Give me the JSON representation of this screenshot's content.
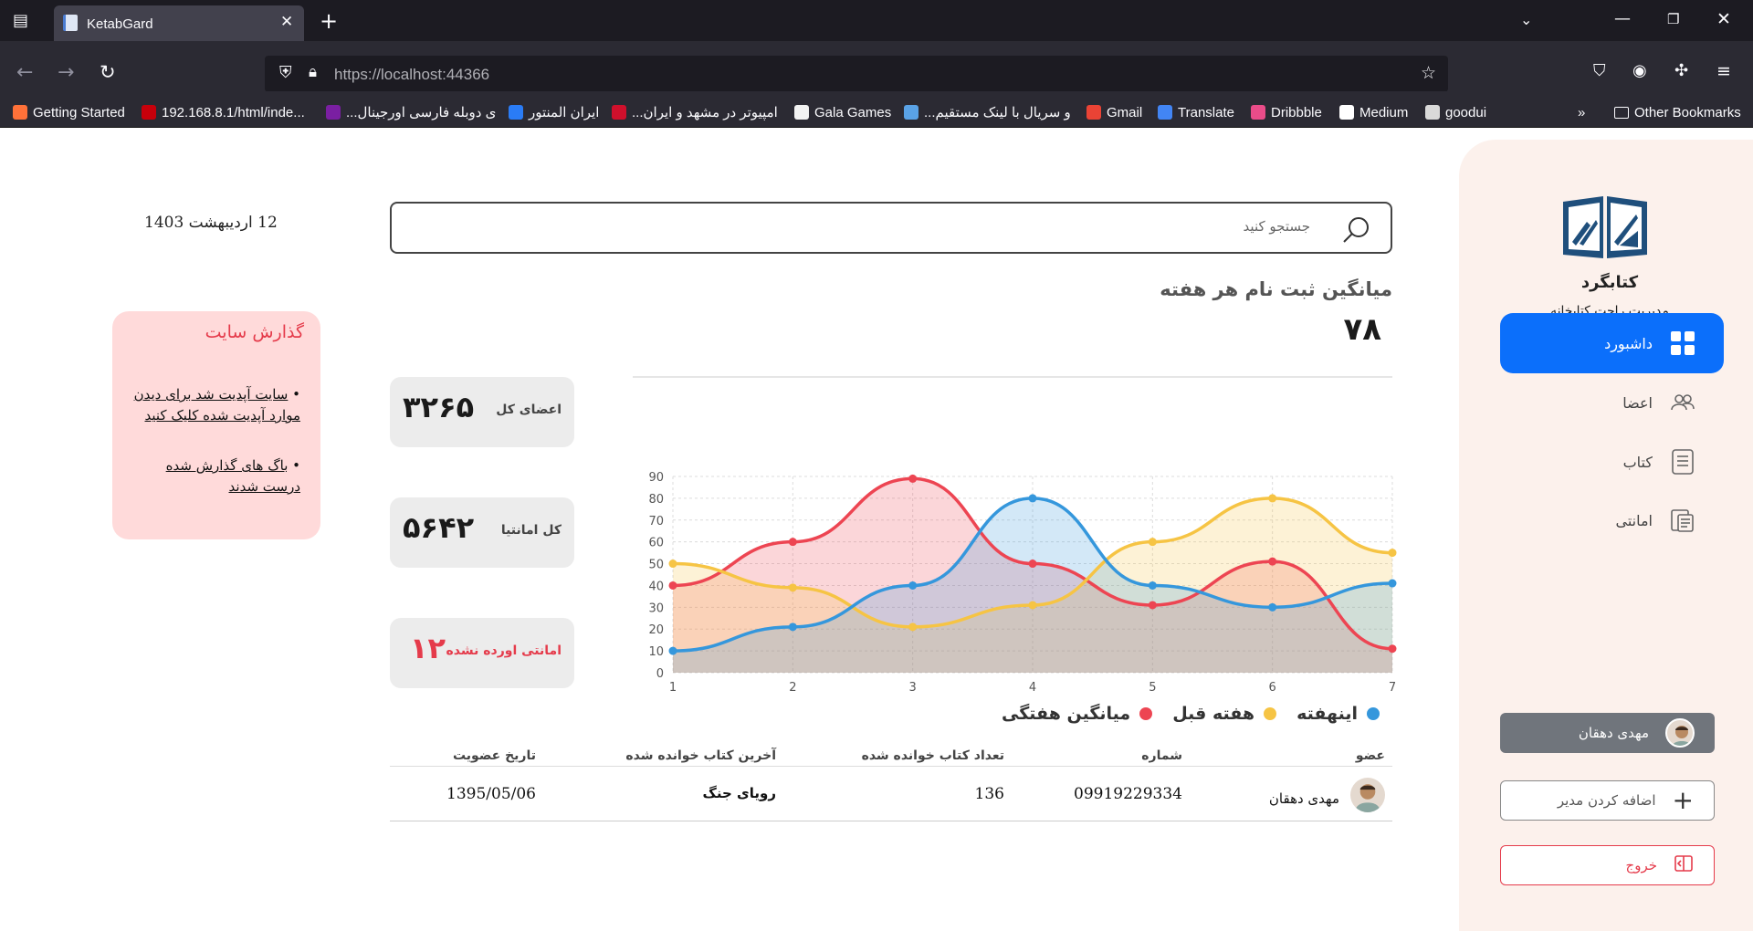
{
  "browser": {
    "tab_title": "KetabGard",
    "url_host": "https://localhost",
    "url_port": ":44366",
    "bookmarks": [
      {
        "label": "Getting Started",
        "color": "#ff7139"
      },
      {
        "label": "192.168.8.1/html/inde...",
        "color": "#c7000b"
      },
      {
        "label": "...ی دوبله فارسی اورجینال",
        "color": "#7a1fa2"
      },
      {
        "label": "ایران المنتور",
        "color": "#2a7cf6"
      },
      {
        "label": "...امپیوتر در مشهد و ایران",
        "color": "#d0102c"
      },
      {
        "label": "Gala Games",
        "color": "#f2f2f2"
      },
      {
        "label": "...و سریال با لینک مستقیم",
        "color": "#5aa2e6"
      },
      {
        "label": "Gmail",
        "color": "#ea4335"
      },
      {
        "label": "Translate",
        "color": "#4285f4"
      },
      {
        "label": "Dribbble",
        "color": "#ea4c89"
      },
      {
        "label": "Medium",
        "color": "#ffffff"
      },
      {
        "label": "goodui",
        "color": "#d9d9d9"
      }
    ],
    "other_bookmarks": "Other Bookmarks"
  },
  "sidebar": {
    "brand_name": "کتابگرد",
    "brand_sub": "مدیریت راحت کتابخانه",
    "nav": [
      {
        "label": "داشبورد",
        "icon": "grid-icon",
        "active": true
      },
      {
        "label": "اعضا",
        "icon": "users-icon",
        "active": false
      },
      {
        "label": "کتاب",
        "icon": "book-icon",
        "active": false
      },
      {
        "label": "امانتی",
        "icon": "loan-icon",
        "active": false
      }
    ],
    "user_name": "مهدی دهقان",
    "add_admin": "اضافه کردن مدیر",
    "logout": "خروج"
  },
  "header": {
    "date": "12 اردیبهشت 1403",
    "search_placeholder": "جستجو کنید"
  },
  "report": {
    "title": "گذارش سایت",
    "items": [
      "سایت آپدیت شد برای دیدن موارد آپدیت شده کلیک کنید",
      "باگ های گذارش شده درست شدند"
    ]
  },
  "stats": {
    "avg_title": "میانگین ثبت نام هر هفته",
    "avg_value": "۷۸",
    "cards": [
      {
        "label": "اعضای کل",
        "value": "۳۲۶۵"
      },
      {
        "label": "کل امانتیا",
        "value": "۵۶۴۲"
      },
      {
        "label": "امانتی اورده نشده",
        "value": "۱۲"
      }
    ]
  },
  "chart_data": {
    "type": "area",
    "x": [
      1,
      2,
      3,
      4,
      5,
      6,
      7
    ],
    "ylim": [
      0,
      90
    ],
    "yticks": [
      0,
      10,
      20,
      30,
      40,
      50,
      60,
      70,
      80,
      90
    ],
    "grid": true,
    "legend_position": "bottom",
    "series": [
      {
        "name": "اینهفته",
        "color": "#3597dc",
        "values": [
          10,
          21,
          40,
          80,
          40,
          30,
          41
        ]
      },
      {
        "name": "هفته قبل",
        "color": "#f6c444",
        "values": [
          50,
          39,
          21,
          31,
          60,
          80,
          55
        ]
      },
      {
        "name": "میانگین هفتگی",
        "color": "#ed4552",
        "values": [
          40,
          60,
          89,
          50,
          31,
          51,
          11
        ]
      }
    ]
  },
  "table": {
    "headers": [
      "عضو",
      "شماره",
      "تعداد کتاب خوانده شده",
      "آخرین کتاب خوانده شده",
      "تاریخ عضویت"
    ],
    "rows": [
      [
        "مهدی دهقان",
        "09919229334",
        "136",
        "رویای جنگ",
        "1395/05/06"
      ]
    ]
  }
}
